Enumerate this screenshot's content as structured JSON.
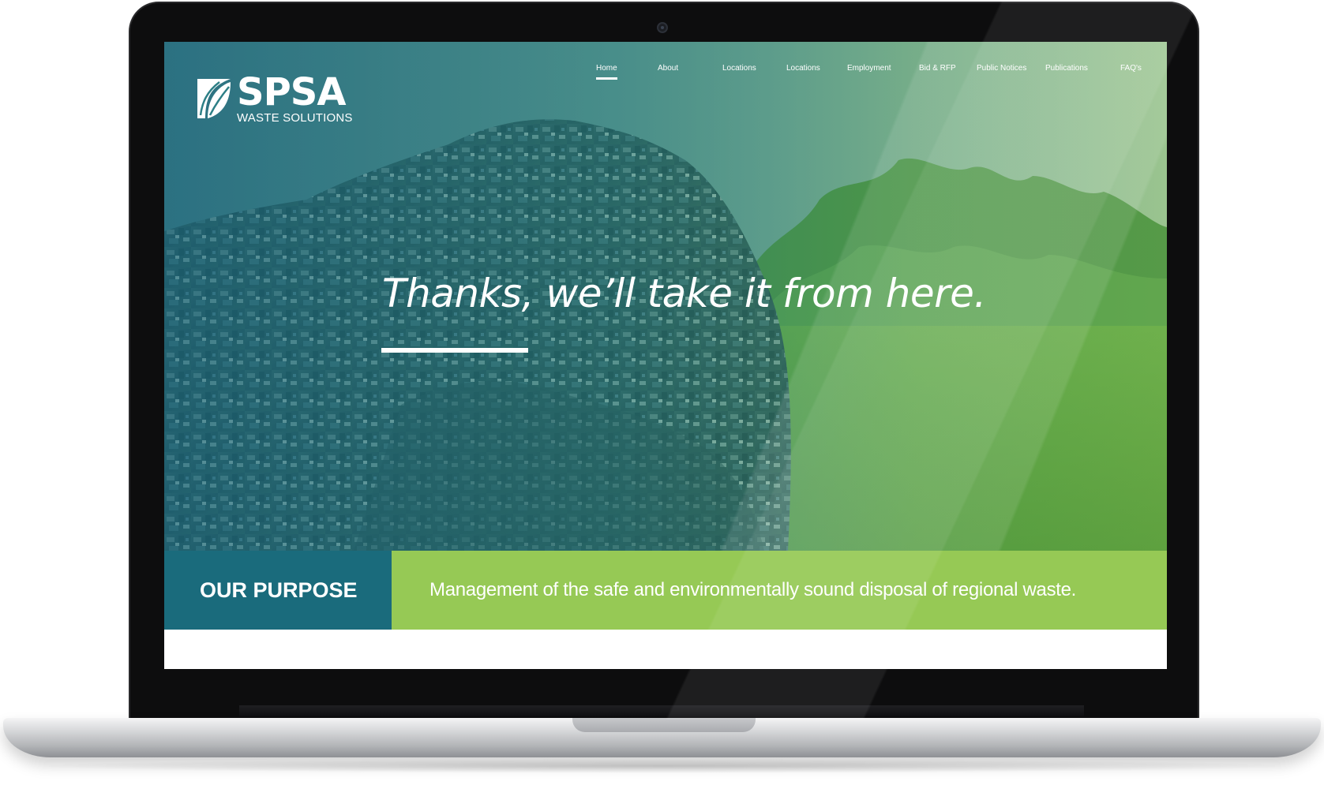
{
  "site": {
    "logo_title": "SPSA",
    "logo_subtitle": "WASTE SOLUTIONS"
  },
  "nav": {
    "items": [
      {
        "label": "Home",
        "active": true
      },
      {
        "label": "About"
      },
      {
        "label": "Locations"
      },
      {
        "label": "Locations"
      },
      {
        "label": "Employment"
      },
      {
        "label": "Bid & RFP"
      },
      {
        "label": "Public Notices"
      },
      {
        "label": "Publications"
      },
      {
        "label": "FAQ's"
      }
    ]
  },
  "hero": {
    "headline": "Thanks, we’ll take it from here."
  },
  "purpose": {
    "label": "OUR PURPOSE",
    "text": "Management of the safe and environmentally sound disposal of regional waste."
  },
  "colors": {
    "teal": "#1a6b7c",
    "green": "#96c955",
    "white": "#ffffff"
  }
}
